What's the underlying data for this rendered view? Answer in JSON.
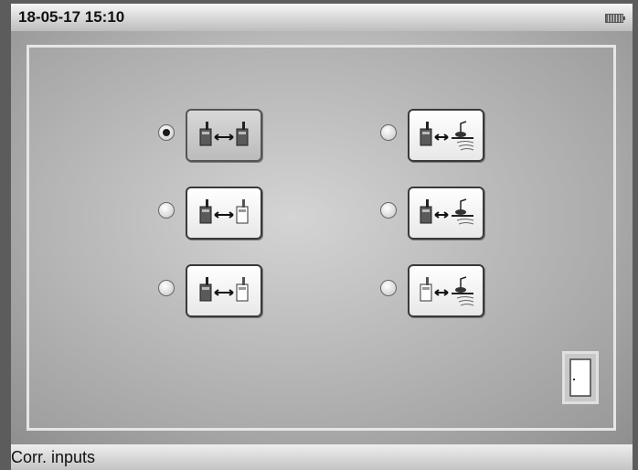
{
  "header": {
    "datetime": "18-05-17 15:10",
    "battery_icon": "battery-full-icon"
  },
  "options": [
    {
      "id": "logger-logger",
      "icon": "logger-to-logger-icon",
      "selected": true
    },
    {
      "id": "logger-hydrophone-1",
      "icon": "logger-to-hydrophone-icon",
      "selected": false
    },
    {
      "id": "logger-sensor-white",
      "icon": "logger-to-white-sensor-icon",
      "selected": false
    },
    {
      "id": "logger-hydrophone-2",
      "icon": "logger-to-hydrophone-icon",
      "selected": false
    },
    {
      "id": "logger-sensor-white-2",
      "icon": "logger-to-white-sensor-icon",
      "selected": false
    },
    {
      "id": "sensor-hydrophone",
      "icon": "sensor-to-hydrophone-icon",
      "selected": false
    }
  ],
  "exit": {
    "icon": "door-exit-icon"
  },
  "footer": {
    "title": "Corr. inputs"
  }
}
